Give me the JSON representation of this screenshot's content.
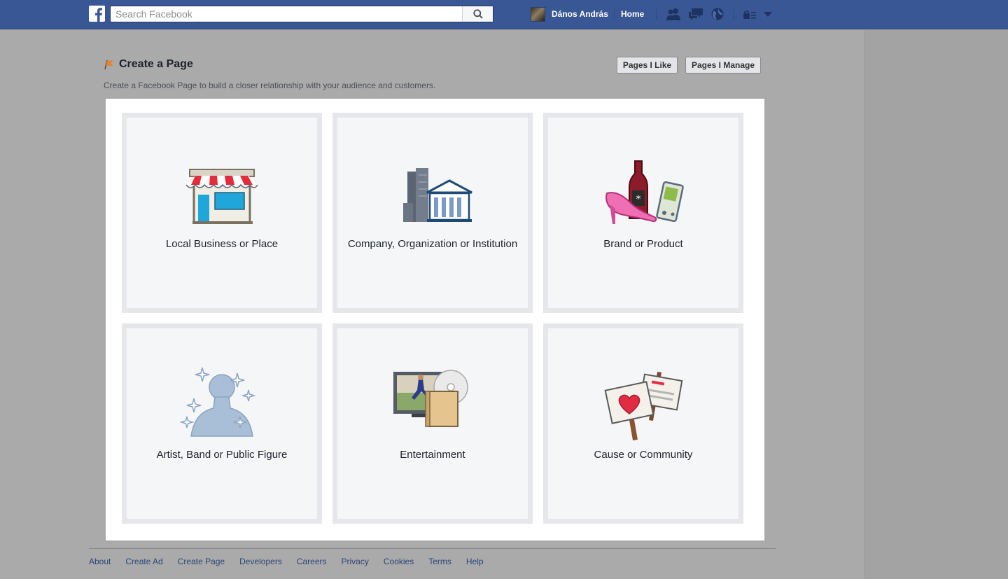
{
  "topbar": {
    "search_placeholder": "Search Facebook",
    "user_name": "Dános András",
    "home_label": "Home",
    "icons": [
      "facebook-logo-icon",
      "search-icon",
      "friend-requests-icon",
      "messages-icon",
      "notifications-globe-icon",
      "privacy-shortcuts-icon",
      "account-menu-chevron-icon"
    ]
  },
  "header": {
    "title": "Create a Page",
    "subtitle": "Create a Facebook Page to build a closer relationship with your audience and customers.",
    "buttons": {
      "pages_like": "Pages I Like",
      "pages_manage": "Pages I Manage"
    }
  },
  "categories": [
    {
      "label": "Local Business or Place",
      "icon": "storefront-icon"
    },
    {
      "label": "Company, Organization or Institution",
      "icon": "office-building-icon"
    },
    {
      "label": "Brand or Product",
      "icon": "products-icon"
    },
    {
      "label": "Artist, Band or Public Figure",
      "icon": "public-figure-icon"
    },
    {
      "label": "Entertainment",
      "icon": "entertainment-icon"
    },
    {
      "label": "Cause or Community",
      "icon": "community-signs-icon"
    }
  ],
  "footer": {
    "links": [
      "About",
      "Create Ad",
      "Create Page",
      "Developers",
      "Careers",
      "Privacy",
      "Cookies",
      "Terms",
      "Help"
    ]
  },
  "colors": {
    "topbar_blue": "#3a5795",
    "overlay_gray": "#aaaaaa",
    "link_blue": "#2b4478",
    "tile_border": "#e6e7ea",
    "tile_fill": "#f5f6f7"
  }
}
